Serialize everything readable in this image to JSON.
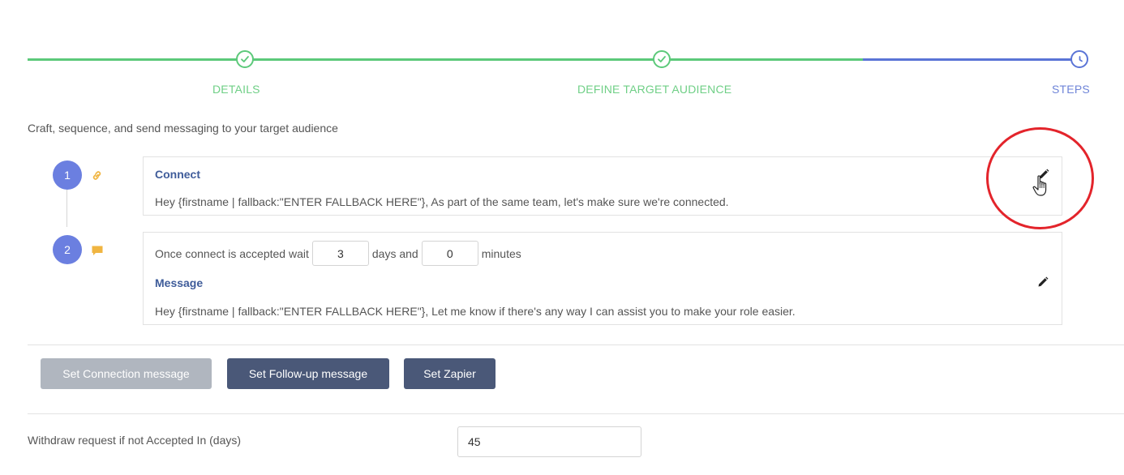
{
  "stepper": {
    "steps": [
      {
        "label": "DETAILS",
        "status": "done"
      },
      {
        "label": "DEFINE TARGET AUDIENCE",
        "status": "done"
      },
      {
        "label": "STEPS",
        "status": "current"
      }
    ],
    "colors": {
      "done": "#5cc97a",
      "current": "#5a74d6"
    }
  },
  "intro_text": "Craft, sequence, and send messaging to your target audience",
  "sequence": [
    {
      "number": "1",
      "type_icon": "link-icon",
      "title": "Connect",
      "body": "Hey {firstname | fallback:\"ENTER FALLBACK HERE\"}, As part of the same team, let's make sure we're connected."
    },
    {
      "number": "2",
      "type_icon": "chat-bubble-icon",
      "wait": {
        "prefix": "Once connect is accepted wait",
        "days_value": "3",
        "days_label": "days and",
        "minutes_value": "0",
        "minutes_label": "minutes"
      },
      "title": "Message",
      "body": "Hey {firstname | fallback:\"ENTER FALLBACK HERE\"}, Let me know if there's any way I can assist you to make your role easier."
    }
  ],
  "actions": {
    "set_connection": "Set Connection message",
    "set_followup": "Set Follow-up message",
    "set_zapier": "Set Zapier"
  },
  "withdraw": {
    "label": "Withdraw request if not Accepted In (days)",
    "value": "45"
  },
  "icons": {
    "edit": "pencil-icon",
    "cursor": "hand-pointer-icon"
  }
}
